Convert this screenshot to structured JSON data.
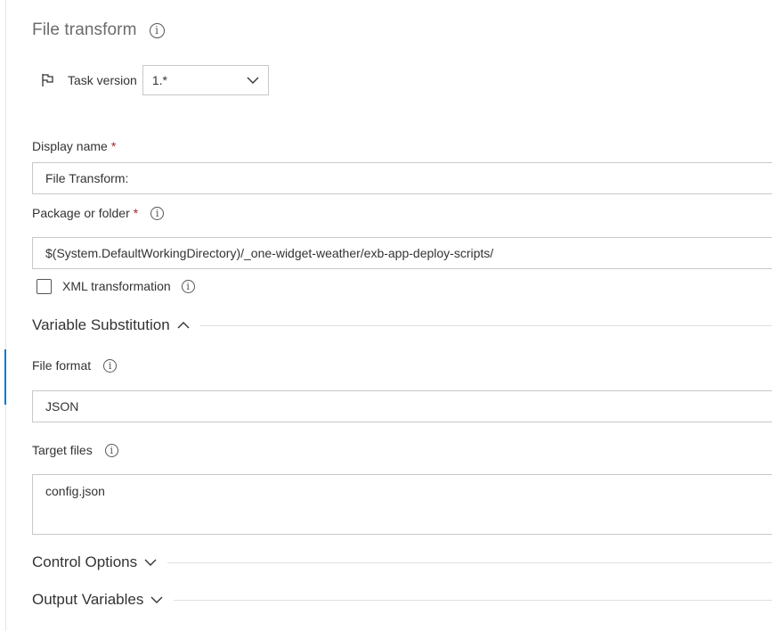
{
  "header": {
    "title": "File transform"
  },
  "task_version": {
    "label": "Task version",
    "value": "1.*"
  },
  "display_name": {
    "label": "Display name",
    "required_mark": "*",
    "value": "File Transform:"
  },
  "package": {
    "label": "Package or folder",
    "required_mark": "*",
    "value": "$(System.DefaultWorkingDirectory)/_one-widget-weather/exb-app-deploy-scripts/"
  },
  "xml_transform": {
    "label": "XML transformation",
    "checked": false
  },
  "variable_substitution": {
    "title": "Variable Substitution",
    "expanded": true
  },
  "file_format": {
    "label": "File format",
    "value": "JSON"
  },
  "target_files": {
    "label": "Target files",
    "value": "config.json"
  },
  "control_options": {
    "title": "Control Options",
    "expanded": false
  },
  "output_variables": {
    "title": "Output Variables",
    "expanded": false
  },
  "icons": {
    "info": "info-icon",
    "flag": "flag-icon",
    "chevron_down": "chevron-down-icon",
    "chevron_up": "chevron-up-icon"
  },
  "colors": {
    "accent": "#0078d4",
    "required": "#a4262c",
    "border": "#c8c8c8"
  }
}
